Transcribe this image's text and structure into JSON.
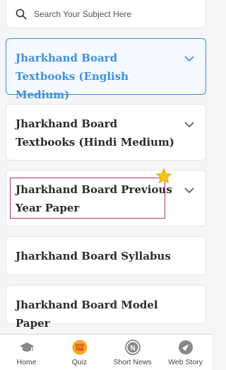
{
  "search": {
    "placeholder": "Search Your Subject Here"
  },
  "cards": [
    {
      "label": "Jharkhand Board Textbooks (English Medium)",
      "expanded": true
    },
    {
      "label": "Jharkhand Board Textbooks (Hindi Medium)",
      "expanded": false
    },
    {
      "label": "Jharkhand Board Previous Year Paper",
      "expanded": false
    },
    {
      "label": "Jharkhand Board Syllabus",
      "expanded": false
    },
    {
      "label": "Jharkhand Board Model Paper",
      "expanded": false
    }
  ],
  "bottom_nav": [
    {
      "label": "Home",
      "icon": "graduation-cap-icon"
    },
    {
      "label": "Quiz",
      "icon": "quiz-time-icon",
      "badge": "QUIZ TIME"
    },
    {
      "label": "Short News",
      "icon": "news-icon",
      "badge": "N"
    },
    {
      "label": "Web Story",
      "icon": "web-story-icon"
    }
  ],
  "colors": {
    "accent": "#3d8fe0",
    "highlight": "#b0307a",
    "star": "#f5c518"
  }
}
